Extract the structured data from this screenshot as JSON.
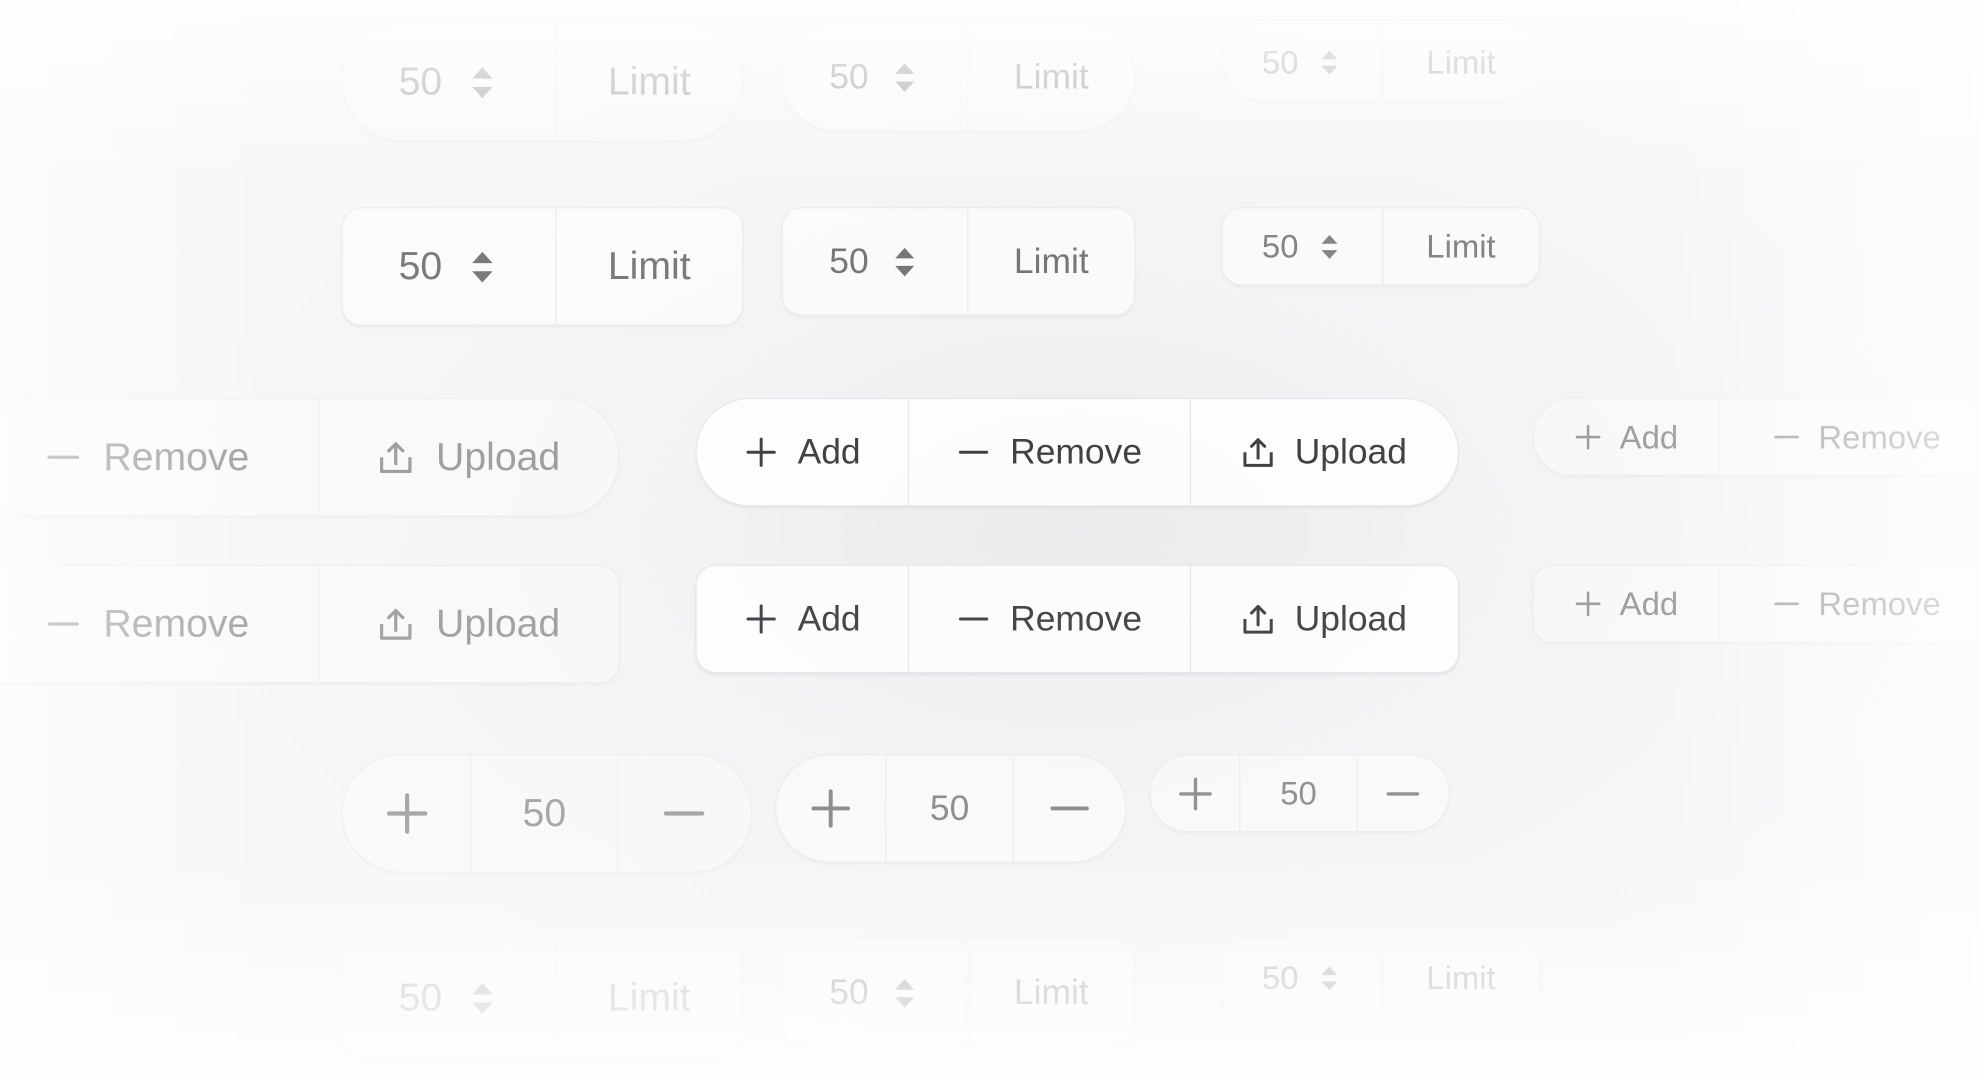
{
  "number_limit_groups": [
    {
      "value": "50",
      "action_label": "Limit",
      "style": "pill",
      "size": "lg",
      "opacity": 0.32
    },
    {
      "value": "50",
      "action_label": "Limit",
      "style": "pill",
      "size": "md",
      "opacity": 0.35
    },
    {
      "value": "50",
      "action_label": "Limit",
      "style": "pill",
      "size": "sm",
      "opacity": 0.28
    },
    {
      "value": "50",
      "action_label": "Limit",
      "style": "rounded",
      "size": "lg",
      "opacity": 0.6
    },
    {
      "value": "50",
      "action_label": "Limit",
      "style": "rounded",
      "size": "md",
      "opacity": 0.62
    },
    {
      "value": "50",
      "action_label": "Limit",
      "style": "rounded",
      "size": "sm",
      "opacity": 0.55
    },
    {
      "value": "50",
      "action_label": "Limit",
      "style": "rounded",
      "size": "lg",
      "opacity": 0.22
    },
    {
      "value": "50",
      "action_label": "Limit",
      "style": "rounded",
      "size": "md",
      "opacity": 0.3
    },
    {
      "value": "50",
      "action_label": "Limit",
      "style": "rounded",
      "size": "sm",
      "opacity": 0.25
    }
  ],
  "action_groups": [
    {
      "style": "pill",
      "size": "lg",
      "opacity": 0.42,
      "buttons": [
        {
          "icon": "minus-icon",
          "label": "Remove"
        },
        {
          "icon": "upload-icon",
          "label": "Upload"
        }
      ]
    },
    {
      "style": "pill",
      "size": "md",
      "opacity": 0.88,
      "buttons": [
        {
          "icon": "plus-icon",
          "label": "Add"
        },
        {
          "icon": "minus-icon",
          "label": "Remove"
        },
        {
          "icon": "upload-icon",
          "label": "Upload"
        }
      ]
    },
    {
      "style": "pill",
      "size": "sm",
      "opacity": 0.42,
      "buttons": [
        {
          "icon": "plus-icon",
          "label": "Add"
        },
        {
          "icon": "minus-icon",
          "label": "Remove"
        }
      ]
    },
    {
      "style": "rounded",
      "size": "lg",
      "opacity": 0.4,
      "buttons": [
        {
          "icon": "minus-icon",
          "label": "Remove"
        },
        {
          "icon": "upload-icon",
          "label": "Upload"
        }
      ]
    },
    {
      "style": "rounded",
      "size": "md",
      "opacity": 0.85,
      "buttons": [
        {
          "icon": "plus-icon",
          "label": "Add"
        },
        {
          "icon": "minus-icon",
          "label": "Remove"
        },
        {
          "icon": "upload-icon",
          "label": "Upload"
        }
      ]
    },
    {
      "style": "rounded",
      "size": "sm",
      "opacity": 0.42,
      "buttons": [
        {
          "icon": "plus-icon",
          "label": "Add"
        },
        {
          "icon": "minus-icon",
          "label": "Remove"
        }
      ]
    }
  ],
  "quantity_steppers": [
    {
      "value": "50",
      "increment_icon": "plus-icon",
      "decrement_icon": "minus-icon",
      "style": "pill",
      "size": "lg",
      "opacity": 0.38
    },
    {
      "value": "50",
      "increment_icon": "plus-icon",
      "decrement_icon": "minus-icon",
      "style": "pill",
      "size": "md",
      "opacity": 0.5
    },
    {
      "value": "50",
      "increment_icon": "plus-icon",
      "decrement_icon": "minus-icon",
      "style": "pill",
      "size": "sm",
      "opacity": 0.48
    }
  ],
  "colors": {
    "page_background": "#f7f7f8",
    "control_background": "#ffffff",
    "control_border": "#e6e6ea",
    "control_text": "#2a2a2e"
  }
}
